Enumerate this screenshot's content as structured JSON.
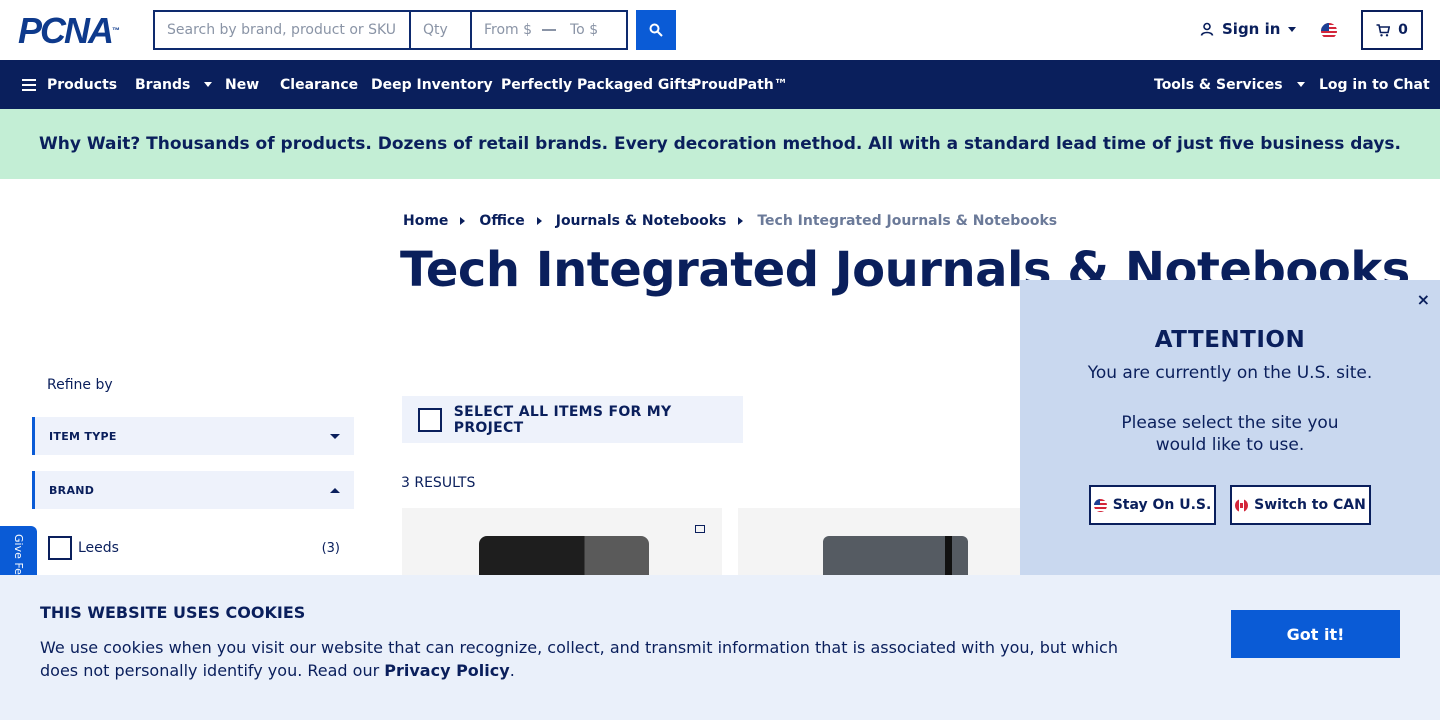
{
  "header": {
    "logo": "PCNA",
    "logo_tm": "™",
    "search_placeholder": "Search by brand, product or SKU",
    "qty_placeholder": "Qty",
    "from_placeholder": "From $",
    "to_placeholder": "To $",
    "signin_label": "Sign in",
    "cart_count": "0"
  },
  "nav": {
    "products": "Products",
    "brands": "Brands",
    "new": "New",
    "clearance": "Clearance",
    "deep_inventory": "Deep Inventory",
    "gifts": "Perfectly Packaged Gifts",
    "proudpath": "ProudPath™",
    "tools": "Tools & Services",
    "chat": "Log in to Chat"
  },
  "banner": "Why Wait? Thousands of products. Dozens of retail brands. Every decoration method. All with a standard lead time of just five business days.",
  "breadcrumb": {
    "home": "Home",
    "office": "Office",
    "journals": "Journals & Notebooks",
    "current": "Tech Integrated Journals & Notebooks"
  },
  "page_title": "Tech Integrated Journals & Notebooks",
  "sidebar": {
    "refine_by": "Refine by",
    "facets": {
      "item_type": "ITEM TYPE",
      "brand": "BRAND"
    },
    "brands": [
      {
        "label": "Leeds",
        "count": "(3)"
      }
    ],
    "feedback": "Give Feedback"
  },
  "results": {
    "select_all": "SELECT ALL ITEMS FOR MY PROJECT",
    "count": "3 RESULTS"
  },
  "attention": {
    "title": "ATTENTION",
    "line1": "You are currently on the U.S. site.",
    "line2": "Please select the site you would like to use.",
    "stay_us": "Stay On U.S.",
    "switch_can": "Switch to CAN",
    "close": "×"
  },
  "cookie": {
    "title": "THIS WEBSITE USES COOKIES",
    "text": "We use cookies when you visit our website that can recognize, collect, and transmit information that is associated with you, but which does not personally identify you. Read our ",
    "link": "Privacy Policy",
    "end": ".",
    "button": "Got it!"
  },
  "colors": {
    "navy": "#0a1f5c",
    "accent": "#0a5bd6",
    "banner_bg": "#c3eed5",
    "popup_bg": "#c9d8ef"
  }
}
